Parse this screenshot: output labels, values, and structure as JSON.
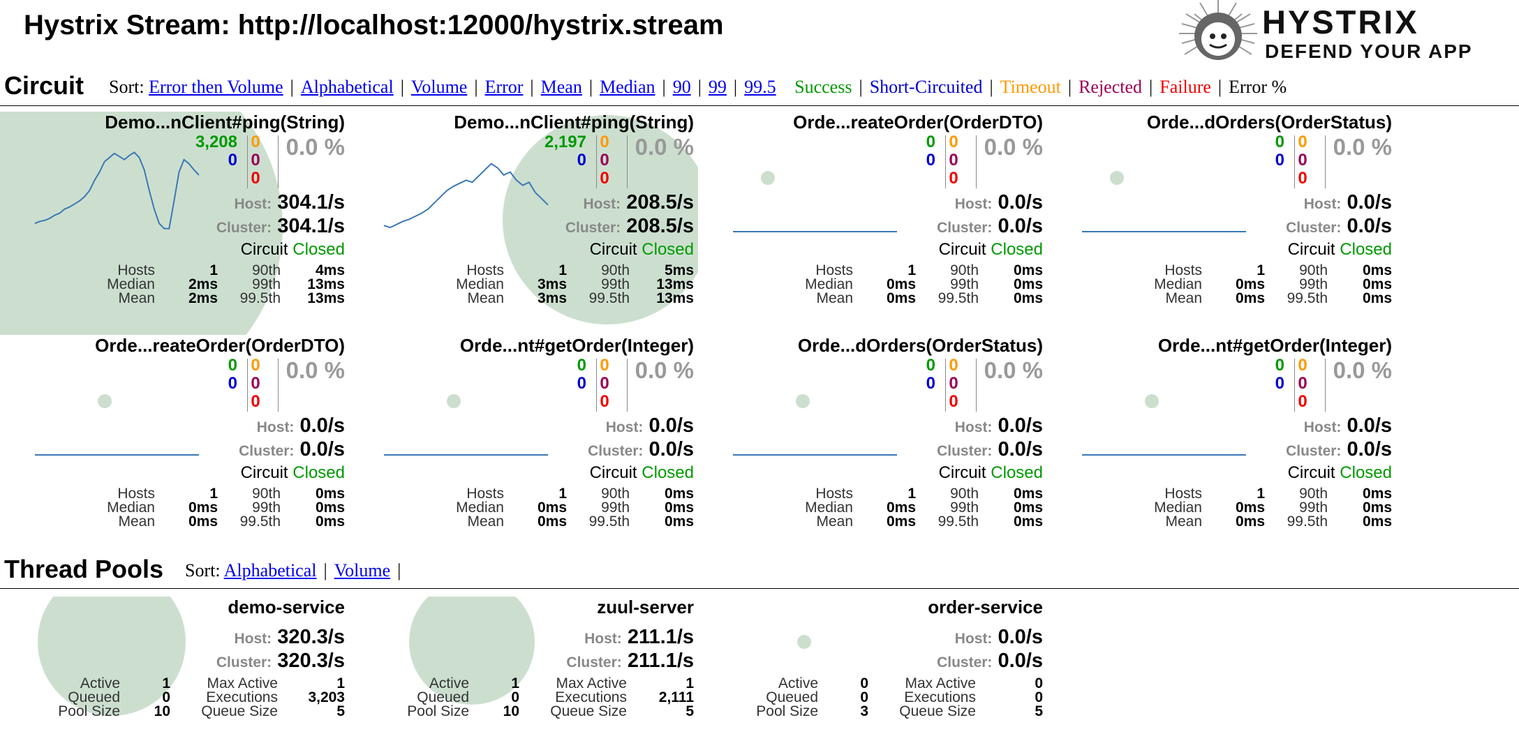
{
  "page": {
    "title": "Hystrix Stream: http://localhost:12000/hystrix.stream"
  },
  "logo": {
    "line1": "HYSTRIX",
    "line2": "DEFEND YOUR APP"
  },
  "circuit_section": {
    "title": "Circuit",
    "sort_label": "Sort:",
    "sort_links": [
      "Error then Volume",
      "Alphabetical",
      "Volume",
      "Error",
      "Mean",
      "Median",
      "90",
      "99",
      "99.5"
    ],
    "legend": [
      "Success",
      "Short-Circuited",
      "Timeout",
      "Rejected",
      "Failure",
      "Error %"
    ]
  },
  "labels": {
    "host": "Host:",
    "cluster": "Cluster:",
    "circuit": "Circuit",
    "hosts": "Hosts",
    "median": "Median",
    "mean": "Mean",
    "p90": "90th",
    "p99": "99th",
    "p995": "99.5th",
    "active": "Active",
    "queued": "Queued",
    "pool_size": "Pool Size",
    "max_active": "Max Active",
    "executions": "Executions",
    "queue_size": "Queue Size"
  },
  "circuits": [
    {
      "name": "Demo...nClient#ping(String)",
      "success": "3,208",
      "short_circuited": "0",
      "timeout": "0",
      "rejected": "0",
      "failure": "0",
      "error_pct": "0.0 %",
      "host_rate": "304.1/s",
      "cluster_rate": "304.1/s",
      "status": "Closed",
      "hosts": "1",
      "median": "2ms",
      "mean": "2ms",
      "p90": "4ms",
      "p99": "13ms",
      "p995": "13ms",
      "rate_series": [
        8,
        10,
        11,
        13,
        16,
        18,
        22,
        24,
        27,
        30,
        34,
        40,
        50,
        58,
        68,
        72,
        76,
        73,
        70,
        74,
        77,
        72,
        60,
        40,
        22,
        8,
        3,
        3,
        30,
        58,
        70,
        66,
        60,
        55
      ]
    },
    {
      "name": "Demo...nClient#ping(String)",
      "success": "2,197",
      "short_circuited": "0",
      "timeout": "0",
      "rejected": "0",
      "failure": "0",
      "error_pct": "0.0 %",
      "host_rate": "208.5/s",
      "cluster_rate": "208.5/s",
      "status": "Closed",
      "hosts": "1",
      "median": "3ms",
      "mean": "3ms",
      "p90": "5ms",
      "p99": "13ms",
      "p995": "13ms",
      "rate_series": [
        6,
        4,
        7,
        10,
        12,
        15,
        18,
        22,
        28,
        34,
        40,
        44,
        47,
        50,
        48,
        54,
        60,
        66,
        62,
        55,
        58,
        50,
        45,
        48,
        38,
        32,
        26
      ]
    },
    {
      "name": "Orde...reateOrder(OrderDTO)",
      "success": "0",
      "short_circuited": "0",
      "timeout": "0",
      "rejected": "0",
      "failure": "0",
      "error_pct": "0.0 %",
      "host_rate": "0.0/s",
      "cluster_rate": "0.0/s",
      "status": "Closed",
      "hosts": "1",
      "median": "0ms",
      "mean": "0ms",
      "p90": "0ms",
      "p99": "0ms",
      "p995": "0ms",
      "rate_series": [
        0,
        0,
        0,
        0,
        0,
        0
      ]
    },
    {
      "name": "Orde...dOrders(OrderStatus)",
      "success": "0",
      "short_circuited": "0",
      "timeout": "0",
      "rejected": "0",
      "failure": "0",
      "error_pct": "0.0 %",
      "host_rate": "0.0/s",
      "cluster_rate": "0.0/s",
      "status": "Closed",
      "hosts": "1",
      "median": "0ms",
      "mean": "0ms",
      "p90": "0ms",
      "p99": "0ms",
      "p995": "0ms",
      "rate_series": [
        0,
        0,
        0,
        0,
        0,
        0
      ]
    },
    {
      "name": "Orde...reateOrder(OrderDTO)",
      "success": "0",
      "short_circuited": "0",
      "timeout": "0",
      "rejected": "0",
      "failure": "0",
      "error_pct": "0.0 %",
      "host_rate": "0.0/s",
      "cluster_rate": "0.0/s",
      "status": "Closed",
      "hosts": "1",
      "median": "0ms",
      "mean": "0ms",
      "p90": "0ms",
      "p99": "0ms",
      "p995": "0ms",
      "rate_series": [
        0,
        0,
        0,
        0,
        0,
        0
      ]
    },
    {
      "name": "Orde...nt#getOrder(Integer)",
      "success": "0",
      "short_circuited": "0",
      "timeout": "0",
      "rejected": "0",
      "failure": "0",
      "error_pct": "0.0 %",
      "host_rate": "0.0/s",
      "cluster_rate": "0.0/s",
      "status": "Closed",
      "hosts": "1",
      "median": "0ms",
      "mean": "0ms",
      "p90": "0ms",
      "p99": "0ms",
      "p995": "0ms",
      "rate_series": [
        0,
        0,
        0,
        0,
        0,
        0
      ]
    },
    {
      "name": "Orde...dOrders(OrderStatus)",
      "success": "0",
      "short_circuited": "0",
      "timeout": "0",
      "rejected": "0",
      "failure": "0",
      "error_pct": "0.0 %",
      "host_rate": "0.0/s",
      "cluster_rate": "0.0/s",
      "status": "Closed",
      "hosts": "1",
      "median": "0ms",
      "mean": "0ms",
      "p90": "0ms",
      "p99": "0ms",
      "p995": "0ms",
      "rate_series": [
        0,
        0,
        0,
        0,
        0,
        0
      ]
    },
    {
      "name": "Orde...nt#getOrder(Integer)",
      "success": "0",
      "short_circuited": "0",
      "timeout": "0",
      "rejected": "0",
      "failure": "0",
      "error_pct": "0.0 %",
      "host_rate": "0.0/s",
      "cluster_rate": "0.0/s",
      "status": "Closed",
      "hosts": "1",
      "median": "0ms",
      "mean": "0ms",
      "p90": "0ms",
      "p99": "0ms",
      "p995": "0ms",
      "rate_series": [
        0,
        0,
        0,
        0,
        0,
        0
      ]
    }
  ],
  "threadpool_section": {
    "title": "Thread Pools",
    "sort_label": "Sort:",
    "sort_links": [
      "Alphabetical",
      "Volume"
    ]
  },
  "threadpools": [
    {
      "name": "demo-service",
      "host_rate": "320.3/s",
      "cluster_rate": "320.3/s",
      "active": "1",
      "queued": "0",
      "pool_size": "10",
      "max_active": "1",
      "executions": "3,203",
      "queue_size": "5"
    },
    {
      "name": "zuul-server",
      "host_rate": "211.1/s",
      "cluster_rate": "211.1/s",
      "active": "1",
      "queued": "0",
      "pool_size": "10",
      "max_active": "1",
      "executions": "2,111",
      "queue_size": "5"
    },
    {
      "name": "order-service",
      "host_rate": "0.0/s",
      "cluster_rate": "0.0/s",
      "active": "0",
      "queued": "0",
      "pool_size": "3",
      "max_active": "0",
      "executions": "0",
      "queue_size": "5"
    }
  ],
  "colors": {
    "success": "#009900",
    "short_circuited": "#0000cc",
    "timeout": "#ff9900",
    "rejected": "#990055",
    "failure": "#ee0000",
    "closed": "#009900",
    "bubble": "#adcbb2",
    "sparkline": "#3a78b5",
    "link": "#0000ee"
  }
}
